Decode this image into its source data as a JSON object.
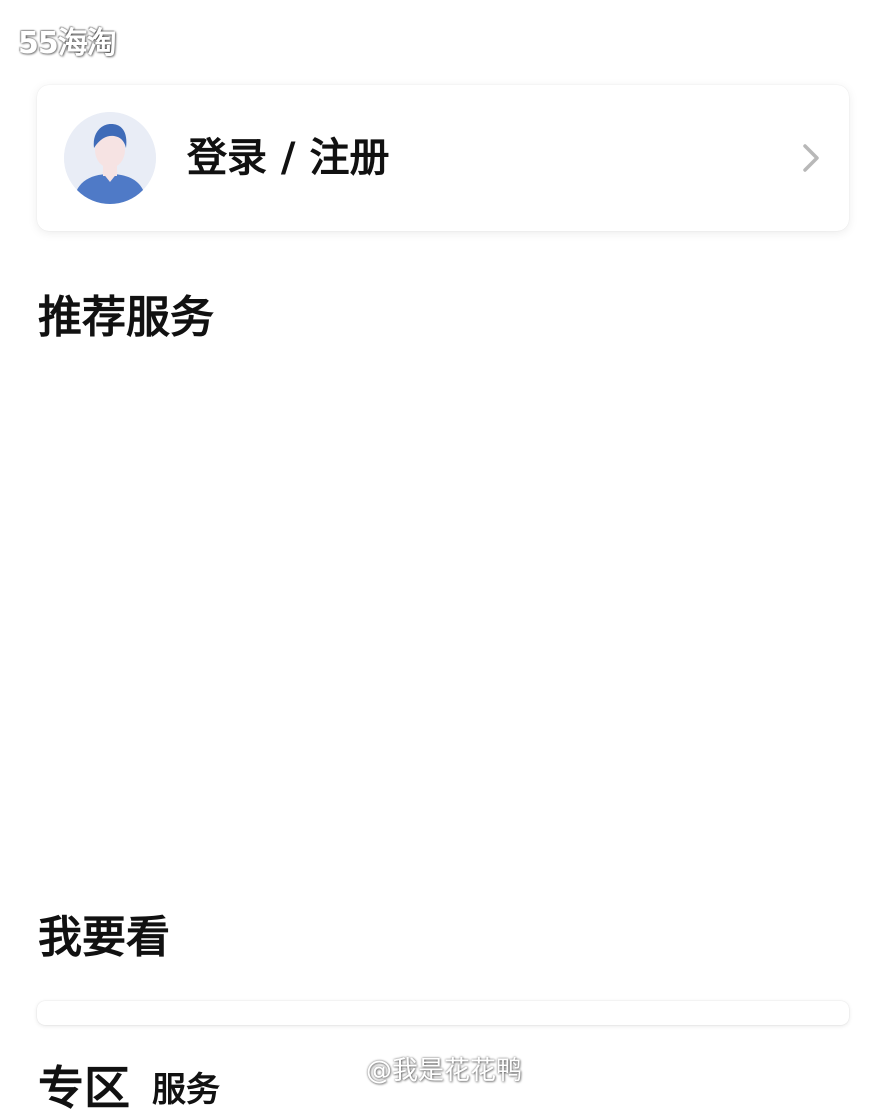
{
  "watermark_top": "55海淘",
  "login_card": {
    "label": "登录 / 注册",
    "avatar_icon": "default-user-avatar-icon",
    "chevron_icon": "chevron-right-icon"
  },
  "sections": {
    "recommend_title": "推荐服务",
    "want_title": "我要看",
    "zone_title": "专区",
    "zone_subtitle": "服务"
  },
  "watermark_bottom": "@我是花花鸭",
  "colors": {
    "background": "#ffffff",
    "text": "#111111",
    "chevron": "#b8b8b8",
    "avatar_bg": "#e9edf6",
    "avatar_shirt": "#4f7ac7",
    "avatar_hair": "#3f6bb8",
    "avatar_skin": "#f6e3e3"
  }
}
